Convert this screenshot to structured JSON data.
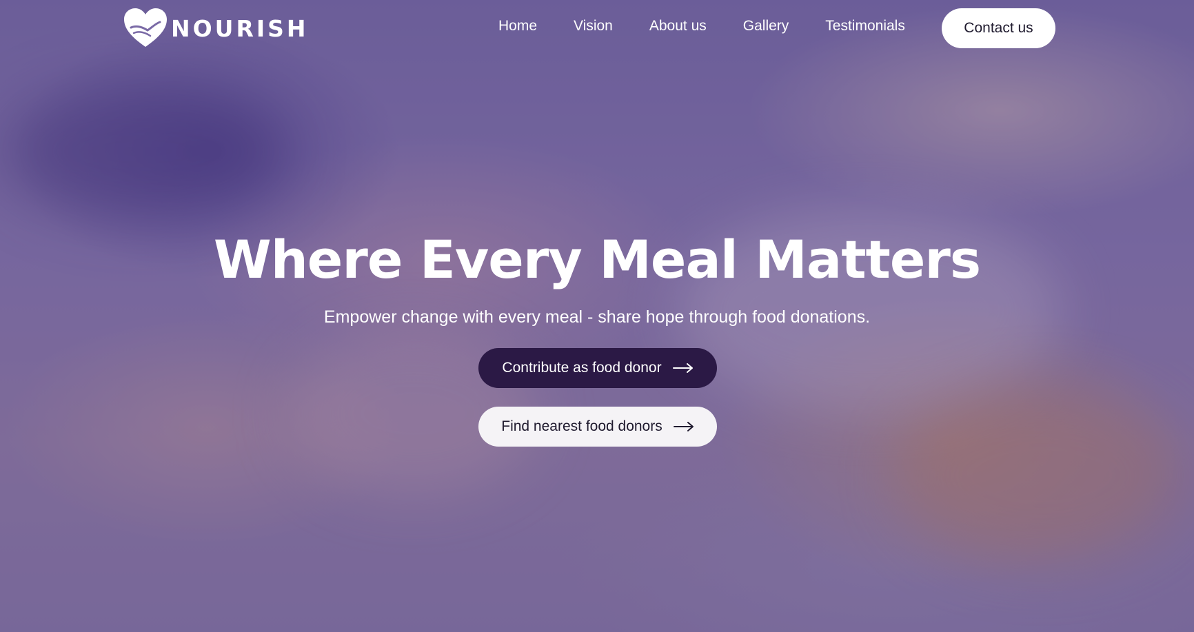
{
  "brand": {
    "name": "NOURISH",
    "logo_icon": "heart-hand-icon"
  },
  "nav": {
    "links": [
      "Home",
      "Vision",
      "About us",
      "Gallery",
      "Testimonials"
    ],
    "contact_label": "Contact us"
  },
  "hero": {
    "headline": "Where Every Meal Matters",
    "subhead": "Empower change with every meal - share hope through food donations.",
    "primary_cta": "Contribute as food donor",
    "secondary_cta": "Find nearest food donors",
    "cta_icon": "arrow-right-icon"
  },
  "colors": {
    "primary_button": "#2b1945",
    "secondary_button": "#f5f3f6",
    "overlay": "#523c82"
  }
}
